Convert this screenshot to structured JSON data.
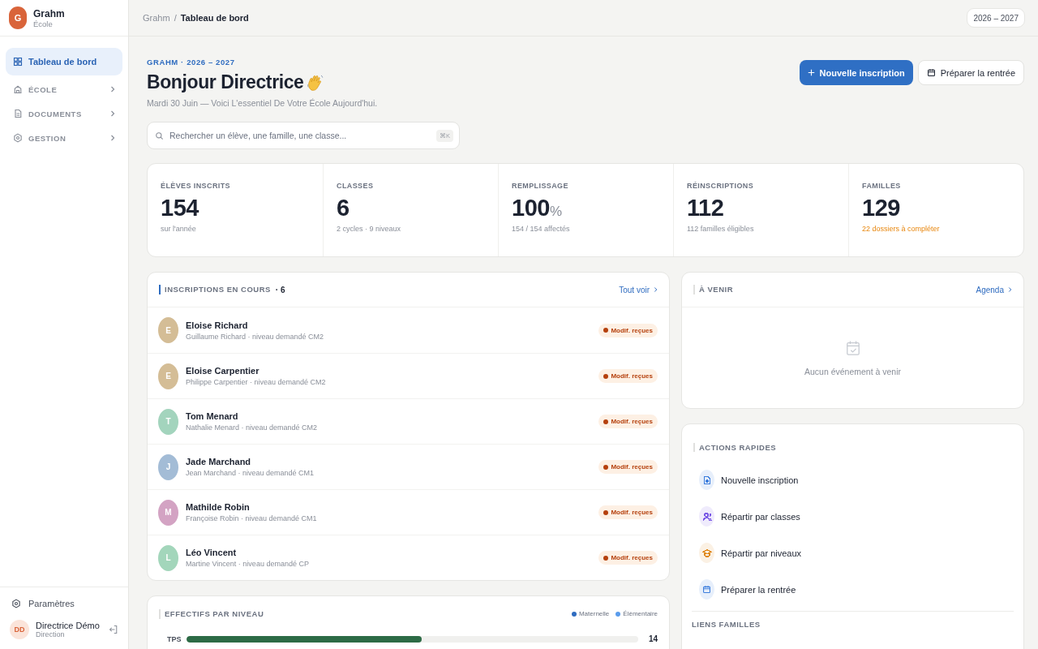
{
  "sidebar": {
    "brand": {
      "initial": "G",
      "name": "Grahm",
      "subtitle": "École"
    },
    "nav": [
      {
        "label": "Tableau de bord",
        "kind": "link",
        "selected": true
      },
      {
        "label": "ÉCOLE",
        "kind": "group",
        "selected": false
      },
      {
        "label": "DOCUMENTS",
        "kind": "group",
        "selected": false
      },
      {
        "label": "GESTION",
        "kind": "group",
        "selected": false
      }
    ],
    "settings": "Paramètres",
    "user": {
      "initials": "DD",
      "name": "Directrice Démo",
      "role": "Direction"
    }
  },
  "topbar": {
    "breadcrumb": [
      "Grahm",
      "Tableau de bord"
    ],
    "separator": "/",
    "year": "2026 – 2027"
  },
  "header": {
    "eyebrow": "GRAHM · 2026 – 2027",
    "title": "Bonjour Directrice",
    "subtitle": "Mardi 30 Juin — Voici L'essentiel De Votre École Aujourd'hui.",
    "actions": [
      {
        "label": "Nouvelle inscription",
        "kind": "primary"
      },
      {
        "label": "Préparer la rentrée",
        "kind": "secondary"
      }
    ]
  },
  "search": {
    "placeholder": "Rechercher un élève, une famille, une classe...",
    "shortcut": "⌘K"
  },
  "stats": [
    {
      "label": "ÉLÈVES INSCRITS",
      "value": "154",
      "note": "sur l'année",
      "alert": false
    },
    {
      "label": "CLASSES",
      "value": "6",
      "note": "2 cycles · 9 niveaux",
      "alert": false
    },
    {
      "label": "REMPLISSAGE",
      "value": "100",
      "unit": "%",
      "note": "154 / 154 affectés",
      "alert": false
    },
    {
      "label": "RÉINSCRIPTIONS",
      "value": "112",
      "note": "112 familles éligibles",
      "alert": false
    },
    {
      "label": "FAMILLES",
      "value": "129",
      "note": "22 dossiers à compléter",
      "alert": true
    }
  ],
  "enrollments": {
    "title": "INSCRIPTIONS EN COURS",
    "count": "· 6",
    "link": "Tout voir",
    "rows": [
      {
        "initial": "E",
        "name": "Eloise Richard",
        "detail": "Guillaume Richard · niveau demandé CM2",
        "status": "Modif. reçues",
        "color": "#d4bd96"
      },
      {
        "initial": "E",
        "name": "Eloise Carpentier",
        "detail": "Philippe Carpentier · niveau demandé CM2",
        "status": "Modif. reçues",
        "color": "#d4bd96"
      },
      {
        "initial": "T",
        "name": "Tom Menard",
        "detail": "Nathalie Menard · niveau demandé CM2",
        "status": "Modif. reçues",
        "color": "#a3d4bd"
      },
      {
        "initial": "J",
        "name": "Jade Marchand",
        "detail": "Jean Marchand · niveau demandé CM1",
        "status": "Modif. reçues",
        "color": "#a3bcd6"
      },
      {
        "initial": "M",
        "name": "Mathilde Robin",
        "detail": "Françoise Robin · niveau demandé CM1",
        "status": "Modif. reçues",
        "color": "#d3a3c3"
      },
      {
        "initial": "L",
        "name": "Léo Vincent",
        "detail": "Martine Vincent · niveau demandé CP",
        "status": "Modif. reçues",
        "color": "#a3d6bb"
      }
    ]
  },
  "levels": {
    "title": "EFFECTIFS PAR NIVEAU",
    "legend": [
      {
        "label": "Maternelle",
        "color": "#2f6cc0"
      },
      {
        "label": "Élémentaire",
        "color": "#5a9cec"
      }
    ],
    "rows": [
      {
        "label": "TPS",
        "level": 0.52,
        "count": "14"
      }
    ]
  },
  "upcoming": {
    "title": "À VENIR",
    "link": "Agenda",
    "empty": "Aucun événement à venir"
  },
  "quick_actions": {
    "title": "ACTIONS RAPIDES",
    "items": [
      {
        "label": "Nouvelle inscription",
        "color": "#3b7ddd"
      },
      {
        "label": "Répartir par classes",
        "color": "#7c5ce6"
      },
      {
        "label": "Répartir par niveaux",
        "color": "#e08a1e"
      },
      {
        "label": "Préparer la rentrée",
        "color": "#3b7ddd"
      }
    ]
  },
  "family_links": {
    "title": "LIENS FAMILLES"
  }
}
